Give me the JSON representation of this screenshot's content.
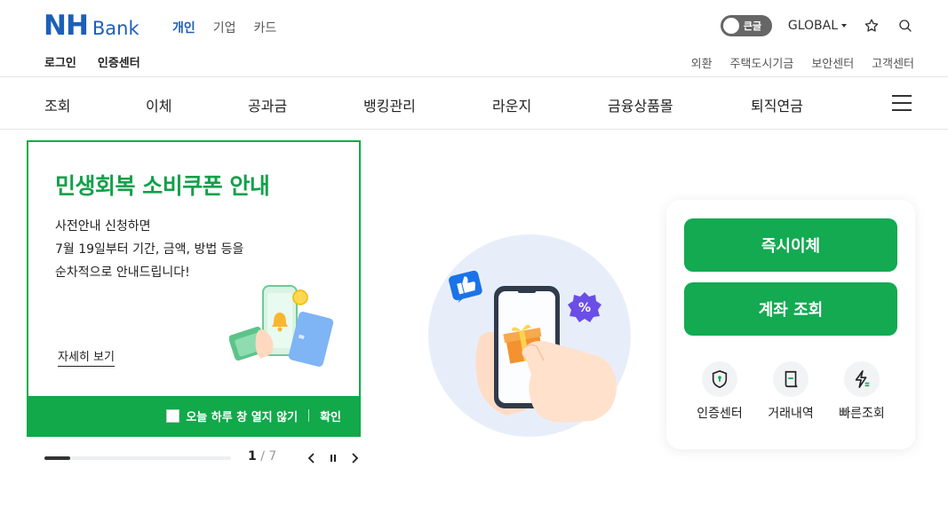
{
  "header": {
    "logo_nh": "NH",
    "logo_bank": "Bank",
    "segments": [
      "개인",
      "기업",
      "카드"
    ],
    "active_segment": "개인",
    "font_toggle_label": "큰글",
    "global_label": "GLOBAL",
    "auth_links": [
      "로그인",
      "인증센터"
    ],
    "util_links": [
      "외환",
      "주택도시기금",
      "보안센터",
      "고객센터"
    ]
  },
  "gnb": {
    "items": [
      "조회",
      "이체",
      "공과금",
      "뱅킹관리",
      "라운지",
      "금융상품몰",
      "퇴직연금"
    ]
  },
  "popup": {
    "title": "민생회복 소비쿠폰 안내",
    "desc_lines": [
      "사전안내 신청하면",
      "7월 19일부터 기간, 금액, 방법 등을",
      "순차적으로 안내드립니다!"
    ],
    "more_label": "자세히 보기",
    "dont_show_label": "오늘 하루 창 열지 않기",
    "confirm_label": "확인"
  },
  "slider": {
    "current": "1",
    "separator": " / ",
    "total": "7",
    "progress": 0.14
  },
  "quick_panel": {
    "transfer_label": "즉시이체",
    "account_label": "계좌 조회",
    "icons": [
      {
        "label": "인증센터",
        "icon": "shield-icon"
      },
      {
        "label": "거래내역",
        "icon": "receipt-icon"
      },
      {
        "label": "빠른조회",
        "icon": "lightning-icon"
      }
    ]
  },
  "colors": {
    "brand_blue": "#1c5fb8",
    "brand_green": "#11a94a",
    "button_green": "#13aa52"
  }
}
